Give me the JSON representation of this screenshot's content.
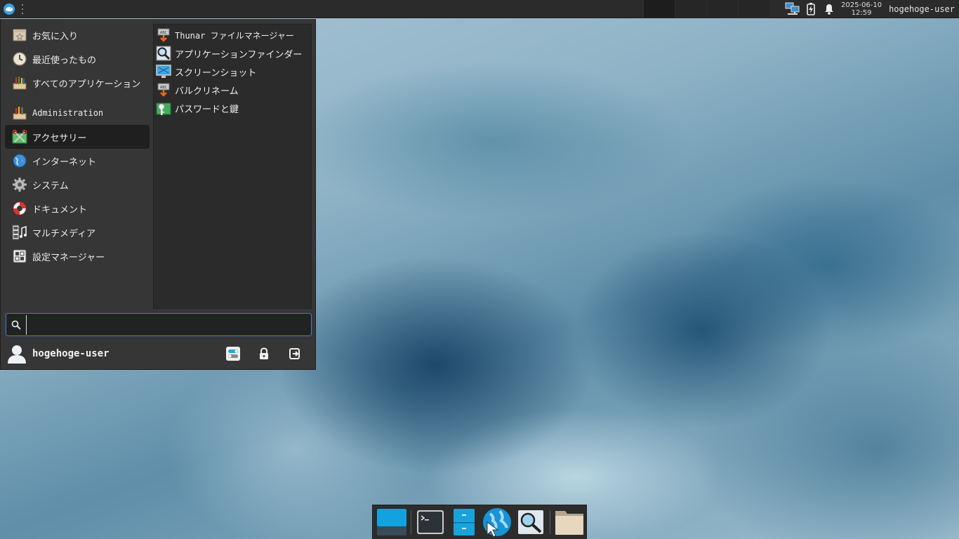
{
  "panel": {
    "menu_button_icon": "xfce-mouse-logo-icon",
    "clock": {
      "date": "2025-06-10",
      "time": "12:59"
    },
    "user": "hogehoge-user",
    "tray_icons": [
      "network-wired-icon",
      "battery-charging-icon",
      "notification-bell-icon"
    ]
  },
  "menu": {
    "categories": [
      {
        "label": "お気に入り",
        "icon": "favorites-icon"
      },
      {
        "label": "最近使ったもの",
        "icon": "recent-clock-icon"
      },
      {
        "label": "すべてのアプリケーション",
        "icon": "all-applications-icon"
      },
      {
        "label": "Administration",
        "icon": "administration-icon"
      },
      {
        "label": "アクセサリー",
        "icon": "accessories-icon",
        "active": true
      },
      {
        "label": "インターネット",
        "icon": "internet-globe-icon"
      },
      {
        "label": "システム",
        "icon": "system-gear-icon"
      },
      {
        "label": "ドキュメント",
        "icon": "documentation-lifebuoy-icon"
      },
      {
        "label": "マルチメディア",
        "icon": "multimedia-icon"
      },
      {
        "label": "設定マネージャー",
        "icon": "settings-manager-icon"
      }
    ],
    "apps": [
      {
        "label": "Thunar ファイルマネージャー",
        "icon": "thunar-file-manager-icon"
      },
      {
        "label": "アプリケーションファインダー",
        "icon": "app-finder-magnifier-icon"
      },
      {
        "label": "スクリーンショット",
        "icon": "screenshot-icon"
      },
      {
        "label": "バルクリネーム",
        "icon": "bulk-rename-icon"
      },
      {
        "label": "パスワードと鍵",
        "icon": "passwords-keys-icon"
      }
    ],
    "search": {
      "value": "",
      "placeholder": ""
    },
    "user": {
      "name": "hogehoge-user"
    },
    "actions": [
      "settings-toggle-icon",
      "lock-screen-icon",
      "log-out-icon"
    ]
  },
  "dock": {
    "items": [
      "show-desktop-icon",
      "terminal-icon",
      "file-manager-icon",
      "web-browser-icon",
      "app-finder-icon",
      "home-folder-icon"
    ]
  },
  "colors": {
    "panel": "#2b2b2b",
    "menu": "#363636",
    "accent": "#3d7ce0"
  }
}
